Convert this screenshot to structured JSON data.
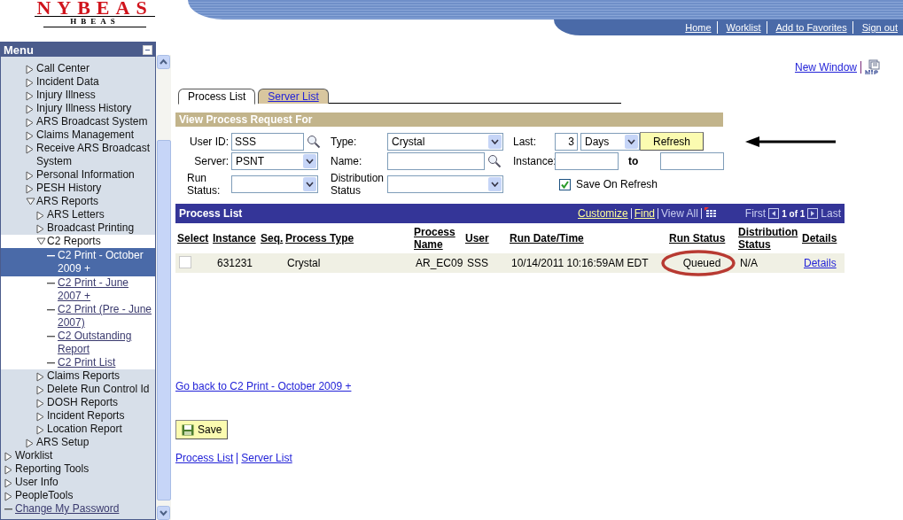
{
  "header": {
    "logo_title": "NYBEAS",
    "logo_subtitle": "HBEAS",
    "nav": [
      "Home",
      "Worklist",
      "Add to Favorites",
      "Sign out"
    ]
  },
  "menu": {
    "title": "Menu",
    "continued_items": [
      {
        "label": "Call Center",
        "kind": "folder",
        "expanded": false
      },
      {
        "label": "Incident Data",
        "kind": "folder",
        "expanded": false
      },
      {
        "label": "Injury Illness",
        "kind": "folder",
        "expanded": false
      },
      {
        "label": "Injury Illness History",
        "kind": "folder",
        "expanded": false
      },
      {
        "label": "ARS Broadcast System",
        "kind": "folder",
        "expanded": false
      },
      {
        "label": "Claims Management",
        "kind": "folder",
        "expanded": false
      },
      {
        "label": "Receive ARS Broadcast System",
        "kind": "folder",
        "expanded": false
      },
      {
        "label": "Personal Information",
        "kind": "folder",
        "expanded": false
      },
      {
        "label": "PESH History",
        "kind": "folder",
        "expanded": false
      },
      {
        "label": "ARS Reports",
        "kind": "folder",
        "expanded": true,
        "children": [
          {
            "label": "ARS Letters",
            "kind": "folder",
            "expanded": false
          },
          {
            "label": "Broadcast Printing",
            "kind": "folder",
            "expanded": false
          },
          {
            "label": "C2 Reports",
            "kind": "folder",
            "expanded": true,
            "children": [
              {
                "label": "C2 Print - October 2009 +",
                "kind": "link",
                "selected": true
              },
              {
                "label": "C2 Print - June 2007 +",
                "kind": "link",
                "selected": false
              },
              {
                "label": "C2 Print (Pre - June 2007)",
                "kind": "link",
                "selected": false
              },
              {
                "label": "C2 Outstanding Report",
                "kind": "link",
                "selected": false
              },
              {
                "label": "C2 Print List",
                "kind": "link",
                "selected": false
              }
            ]
          },
          {
            "label": "Claims Reports",
            "kind": "folder",
            "expanded": false
          },
          {
            "label": "Delete Run Control Id",
            "kind": "folder",
            "expanded": false
          },
          {
            "label": "DOSH Reports",
            "kind": "folder",
            "expanded": false
          },
          {
            "label": "Incident Reports",
            "kind": "folder",
            "expanded": false
          },
          {
            "label": "Location Report",
            "kind": "folder",
            "expanded": false
          }
        ]
      },
      {
        "label": "ARS Setup",
        "kind": "folder",
        "expanded": false
      }
    ],
    "items": [
      {
        "label": "Worklist",
        "kind": "folder",
        "expanded": false
      },
      {
        "label": "Reporting Tools",
        "kind": "folder",
        "expanded": false
      },
      {
        "label": "User Info",
        "kind": "folder",
        "expanded": false
      },
      {
        "label": "PeopleTools",
        "kind": "folder",
        "expanded": false
      },
      {
        "label": "Change My Password",
        "kind": "link",
        "selected": false
      }
    ]
  },
  "new_window": "New Window",
  "tabs": [
    {
      "label": "Process List",
      "selected": true
    },
    {
      "label": "Server List",
      "selected": false
    }
  ],
  "filter": {
    "title": "View Process Request For",
    "user_id": {
      "label": "User ID:",
      "value": "SSS"
    },
    "type": {
      "label": "Type:",
      "value": "Crystal"
    },
    "last": {
      "label": "Last:",
      "value": "3",
      "unit": "Days"
    },
    "refresh": {
      "label": "Refresh",
      "pointed": true
    },
    "server": {
      "label": "Server:",
      "value": "PSNT"
    },
    "name": {
      "label": "Name:"
    },
    "instance": {
      "label": "Instance:",
      "to": "to"
    },
    "run_status": {
      "label": "Run Status:"
    },
    "distribution_status": {
      "label": "Distribution Status"
    },
    "save_on_refresh": {
      "label": "Save On Refresh",
      "checked": true
    }
  },
  "process_list": {
    "title": "Process List",
    "tools": [
      "Customize",
      "Find",
      "View All"
    ],
    "first": "First",
    "count": "1 of 1",
    "last": "Last",
    "columns": [
      "Select",
      "Instance",
      "Seq.",
      "Process Type",
      "Process Name",
      "User",
      "Run Date/Time",
      "Run Status",
      "Distribution Status",
      "Details"
    ],
    "rows": [
      {
        "selected": false,
        "instance": "631231",
        "process_type": "Crystal",
        "process_name": "AR_EC09",
        "user": "SSS",
        "run_datetime": "10/14/2011 10:16:59AM EDT",
        "run_status": "Queued",
        "status_circled": true,
        "distribution_status": "N/A",
        "details": "Details"
      }
    ]
  },
  "go_back": "Go back to C2 Print - October 2009 +",
  "save": "Save",
  "footer_links": [
    "Process List",
    "Server List"
  ]
}
